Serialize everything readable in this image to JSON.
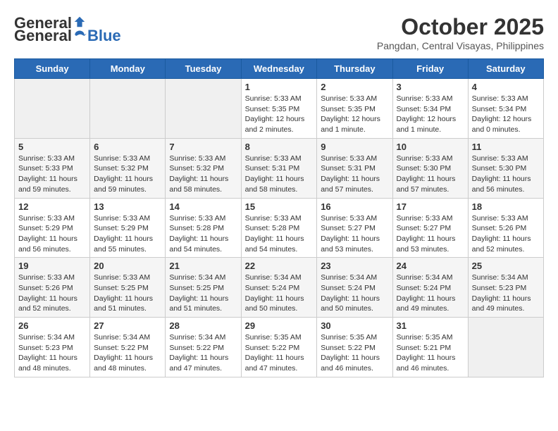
{
  "header": {
    "logo_general": "General",
    "logo_blue": "Blue",
    "month_title": "October 2025",
    "location": "Pangdan, Central Visayas, Philippines"
  },
  "weekdays": [
    "Sunday",
    "Monday",
    "Tuesday",
    "Wednesday",
    "Thursday",
    "Friday",
    "Saturday"
  ],
  "weeks": [
    [
      {
        "day": "",
        "info": ""
      },
      {
        "day": "",
        "info": ""
      },
      {
        "day": "",
        "info": ""
      },
      {
        "day": "1",
        "info": "Sunrise: 5:33 AM\nSunset: 5:35 PM\nDaylight: 12 hours\nand 2 minutes."
      },
      {
        "day": "2",
        "info": "Sunrise: 5:33 AM\nSunset: 5:35 PM\nDaylight: 12 hours\nand 1 minute."
      },
      {
        "day": "3",
        "info": "Sunrise: 5:33 AM\nSunset: 5:34 PM\nDaylight: 12 hours\nand 1 minute."
      },
      {
        "day": "4",
        "info": "Sunrise: 5:33 AM\nSunset: 5:34 PM\nDaylight: 12 hours\nand 0 minutes."
      }
    ],
    [
      {
        "day": "5",
        "info": "Sunrise: 5:33 AM\nSunset: 5:33 PM\nDaylight: 11 hours\nand 59 minutes."
      },
      {
        "day": "6",
        "info": "Sunrise: 5:33 AM\nSunset: 5:32 PM\nDaylight: 11 hours\nand 59 minutes."
      },
      {
        "day": "7",
        "info": "Sunrise: 5:33 AM\nSunset: 5:32 PM\nDaylight: 11 hours\nand 58 minutes."
      },
      {
        "day": "8",
        "info": "Sunrise: 5:33 AM\nSunset: 5:31 PM\nDaylight: 11 hours\nand 58 minutes."
      },
      {
        "day": "9",
        "info": "Sunrise: 5:33 AM\nSunset: 5:31 PM\nDaylight: 11 hours\nand 57 minutes."
      },
      {
        "day": "10",
        "info": "Sunrise: 5:33 AM\nSunset: 5:30 PM\nDaylight: 11 hours\nand 57 minutes."
      },
      {
        "day": "11",
        "info": "Sunrise: 5:33 AM\nSunset: 5:30 PM\nDaylight: 11 hours\nand 56 minutes."
      }
    ],
    [
      {
        "day": "12",
        "info": "Sunrise: 5:33 AM\nSunset: 5:29 PM\nDaylight: 11 hours\nand 56 minutes."
      },
      {
        "day": "13",
        "info": "Sunrise: 5:33 AM\nSunset: 5:29 PM\nDaylight: 11 hours\nand 55 minutes."
      },
      {
        "day": "14",
        "info": "Sunrise: 5:33 AM\nSunset: 5:28 PM\nDaylight: 11 hours\nand 54 minutes."
      },
      {
        "day": "15",
        "info": "Sunrise: 5:33 AM\nSunset: 5:28 PM\nDaylight: 11 hours\nand 54 minutes."
      },
      {
        "day": "16",
        "info": "Sunrise: 5:33 AM\nSunset: 5:27 PM\nDaylight: 11 hours\nand 53 minutes."
      },
      {
        "day": "17",
        "info": "Sunrise: 5:33 AM\nSunset: 5:27 PM\nDaylight: 11 hours\nand 53 minutes."
      },
      {
        "day": "18",
        "info": "Sunrise: 5:33 AM\nSunset: 5:26 PM\nDaylight: 11 hours\nand 52 minutes."
      }
    ],
    [
      {
        "day": "19",
        "info": "Sunrise: 5:33 AM\nSunset: 5:26 PM\nDaylight: 11 hours\nand 52 minutes."
      },
      {
        "day": "20",
        "info": "Sunrise: 5:33 AM\nSunset: 5:25 PM\nDaylight: 11 hours\nand 51 minutes."
      },
      {
        "day": "21",
        "info": "Sunrise: 5:34 AM\nSunset: 5:25 PM\nDaylight: 11 hours\nand 51 minutes."
      },
      {
        "day": "22",
        "info": "Sunrise: 5:34 AM\nSunset: 5:24 PM\nDaylight: 11 hours\nand 50 minutes."
      },
      {
        "day": "23",
        "info": "Sunrise: 5:34 AM\nSunset: 5:24 PM\nDaylight: 11 hours\nand 50 minutes."
      },
      {
        "day": "24",
        "info": "Sunrise: 5:34 AM\nSunset: 5:24 PM\nDaylight: 11 hours\nand 49 minutes."
      },
      {
        "day": "25",
        "info": "Sunrise: 5:34 AM\nSunset: 5:23 PM\nDaylight: 11 hours\nand 49 minutes."
      }
    ],
    [
      {
        "day": "26",
        "info": "Sunrise: 5:34 AM\nSunset: 5:23 PM\nDaylight: 11 hours\nand 48 minutes."
      },
      {
        "day": "27",
        "info": "Sunrise: 5:34 AM\nSunset: 5:22 PM\nDaylight: 11 hours\nand 48 minutes."
      },
      {
        "day": "28",
        "info": "Sunrise: 5:34 AM\nSunset: 5:22 PM\nDaylight: 11 hours\nand 47 minutes."
      },
      {
        "day": "29",
        "info": "Sunrise: 5:35 AM\nSunset: 5:22 PM\nDaylight: 11 hours\nand 47 minutes."
      },
      {
        "day": "30",
        "info": "Sunrise: 5:35 AM\nSunset: 5:22 PM\nDaylight: 11 hours\nand 46 minutes."
      },
      {
        "day": "31",
        "info": "Sunrise: 5:35 AM\nSunset: 5:21 PM\nDaylight: 11 hours\nand 46 minutes."
      },
      {
        "day": "",
        "info": ""
      }
    ]
  ]
}
